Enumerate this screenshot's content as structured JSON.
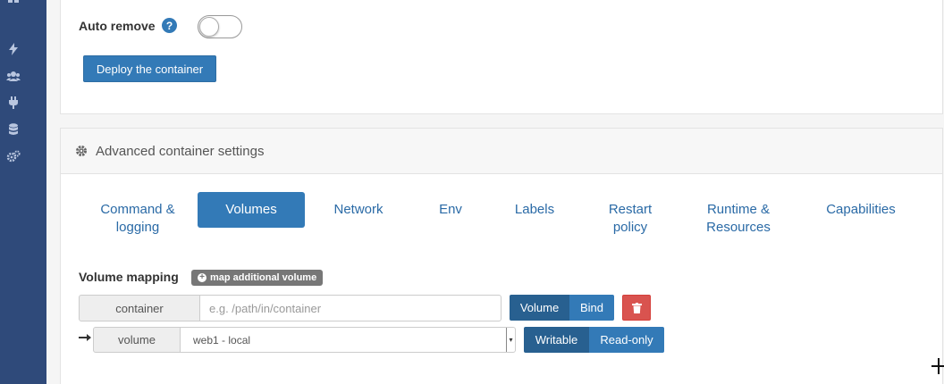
{
  "sidebar": {
    "icons": [
      "bolt-icon",
      "users-icon",
      "plug-icon",
      "database-icon",
      "cogs-icon"
    ]
  },
  "form": {
    "auto_remove_label": "Auto remove",
    "help_icon": "?",
    "auto_remove_enabled": false,
    "deploy_button": "Deploy the container"
  },
  "advanced": {
    "title": "Advanced container settings",
    "tabs": [
      {
        "line1": "Command &",
        "line2": "logging"
      },
      {
        "line1": "Volumes",
        "line2": ""
      },
      {
        "line1": "Network",
        "line2": ""
      },
      {
        "line1": "Env",
        "line2": ""
      },
      {
        "line1": "Labels",
        "line2": ""
      },
      {
        "line1": "Restart",
        "line2": "policy"
      },
      {
        "line1": "Runtime &",
        "line2": "Resources"
      },
      {
        "line1": "Capabilities",
        "line2": ""
      }
    ],
    "active_tab": "Volumes"
  },
  "volumes": {
    "label": "Volume mapping",
    "add_button": "map additional volume",
    "container_addon": "container",
    "container_placeholder": "e.g. /path/in/container",
    "type_options": [
      "Volume",
      "Bind"
    ],
    "type_selected": "Volume",
    "volume_addon": "volume",
    "volume_selected": "web1 - local",
    "mode_options": [
      "Writable",
      "Read-only"
    ],
    "mode_selected": "Writable"
  },
  "colors": {
    "sidebar": "#2f4a7a",
    "primary": "#337ab7",
    "primary_active": "#286090",
    "danger": "#d9534f",
    "badge": "#777777"
  }
}
